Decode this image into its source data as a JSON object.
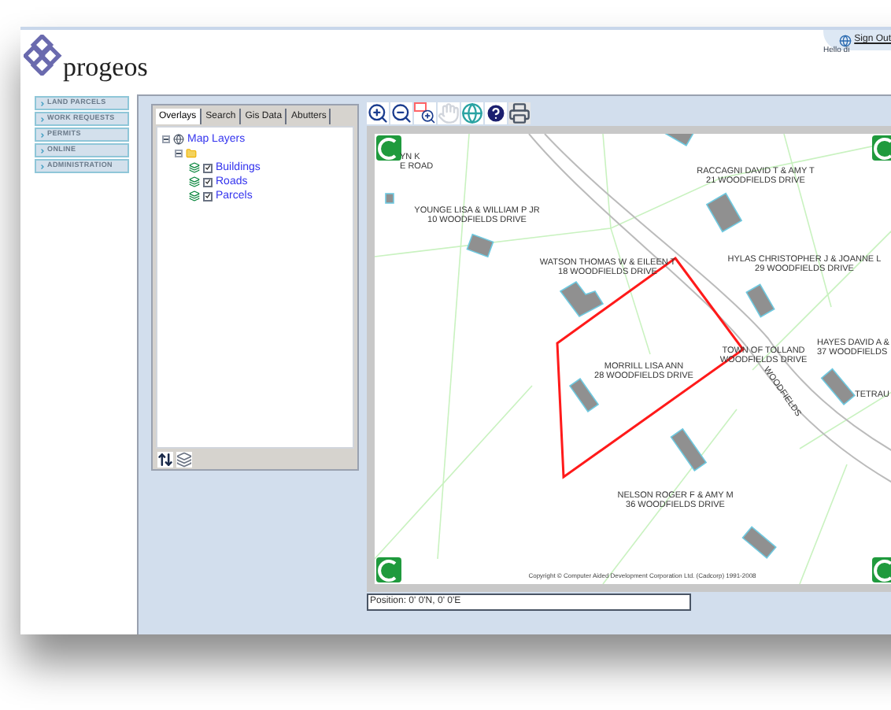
{
  "header": {
    "logo_text": "progeos",
    "sign_out": "Sign Out",
    "greeting": "Hello di"
  },
  "nav": [
    {
      "label": "LAND PARCELS"
    },
    {
      "label": "WORK REQUESTS"
    },
    {
      "label": "PERMITS"
    },
    {
      "label": "ONLINE"
    },
    {
      "label": "ADMINISTRATION"
    }
  ],
  "layer_panel": {
    "tabs": [
      {
        "label": "Overlays",
        "selected": true
      },
      {
        "label": "Search",
        "selected": false
      },
      {
        "label": "Gis Data",
        "selected": false
      },
      {
        "label": "Abutters",
        "selected": false
      }
    ],
    "tree": [
      {
        "label": "Map Layers",
        "expanded": true,
        "children": [
          {
            "expanded": true,
            "children": [
              {
                "label": "Buildings",
                "checked": true
              },
              {
                "label": "Roads",
                "checked": true
              },
              {
                "label": "Parcels",
                "checked": true
              }
            ]
          }
        ]
      }
    ]
  },
  "map": {
    "parcels": [
      {
        "lines": [
          "YN K",
          "E ROAD"
        ]
      },
      {
        "lines": [
          "YOUNGE LISA & WILLIAM P JR",
          "10 WOODFIELDS DRIVE"
        ]
      },
      {
        "lines": [
          "RACCAGNI DAVID T & AMY T",
          "21 WOODFIELDS DRIVE"
        ]
      },
      {
        "lines": [
          "WATSON THOMAS W & EILEEN T",
          "18 WOODFIELDS DRIVE"
        ]
      },
      {
        "lines": [
          "HYLAS CHRISTOPHER J & JOANNE L",
          "29 WOODFIELDS DRIVE"
        ]
      },
      {
        "lines": [
          "MORRILL LISA ANN",
          "28 WOODFIELDS DRIVE"
        ]
      },
      {
        "lines": [
          "TOWN OF TOLLAND",
          "WOODFIELDS DRIVE"
        ]
      },
      {
        "lines": [
          "HAYES DAVID A &",
          "37 WOODFIELDS"
        ]
      },
      {
        "lines": [
          "TETRAU"
        ]
      },
      {
        "lines": [
          "NELSON ROGER F & AMY M",
          "36 WOODFIELDS DRIVE"
        ]
      }
    ],
    "road_label": "WOODFIELDS",
    "copyright": "Copyright © Computer Aided Development Corporation Ltd. (Cadcorp) 1991-2008",
    "position": "Position: 0' 0'N, 0' 0'E"
  }
}
